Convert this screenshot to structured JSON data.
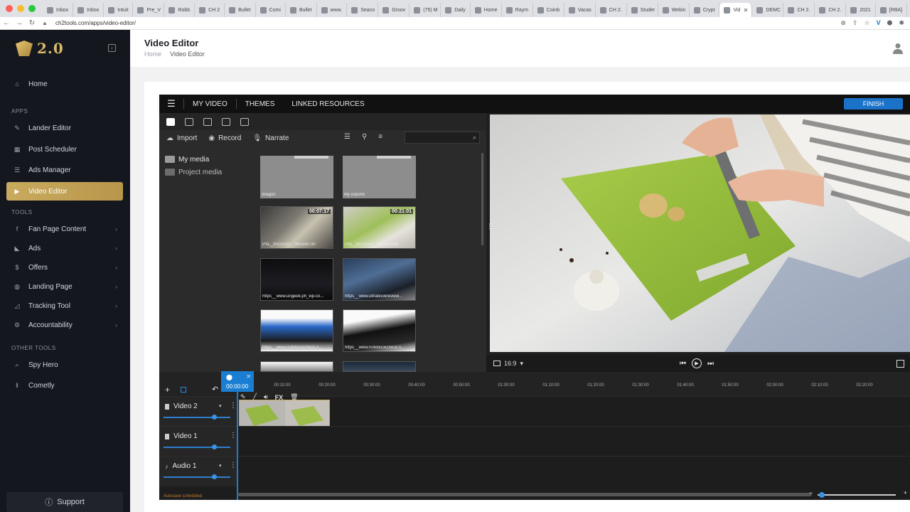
{
  "browser": {
    "tabs": [
      "Inbox",
      "Inbox",
      "Intuit",
      "Pre_V",
      "Robb",
      "CH 2",
      "Bullet",
      "Comi",
      "Bullet",
      "www.",
      "Seaco",
      "Groov",
      "(75) M",
      "Daily",
      "Home",
      "Raym",
      "Coinb",
      "Vacas",
      "CH 2.",
      "Studer",
      "Webin",
      "Crypt",
      "Vid",
      "DEMC",
      "CH 2.",
      "CH 2.",
      "2021",
      "[RBA]"
    ],
    "url": "ch2tools.com/apps/video-editor/"
  },
  "sidebar": {
    "logo_text": "2.0",
    "home": "Home",
    "apps_label": "APPS",
    "apps": [
      "Lander Editor",
      "Post Scheduler",
      "Ads Manager",
      "Video Editor"
    ],
    "tools_label": "TOOLS",
    "tools": [
      "Fan Page Content",
      "Ads",
      "Offers",
      "Landing Page",
      "Tracking Tool",
      "Accountability"
    ],
    "other_label": "OTHER TOOLS",
    "other": [
      "Spy Hero",
      "Cometly"
    ],
    "support": "Support"
  },
  "header": {
    "title": "Video Editor",
    "crumb_home": "Home",
    "crumb_current": "Video Editor"
  },
  "editor": {
    "tabs": [
      "MY VIDEO",
      "THEMES",
      "LINKED RESOURCES"
    ],
    "finish": "FINISH",
    "actions": {
      "import": "Import",
      "record": "Record",
      "narrate": "Narrate"
    },
    "folders": [
      "My media",
      "Project media"
    ],
    "media": [
      {
        "caption": "Images",
        "duration": ""
      },
      {
        "caption": "My exports",
        "duration": ""
      },
      {
        "caption": "PXL_20210207_095326730",
        "duration": "00:07:17"
      },
      {
        "caption": "PXL_20210207_094910336",
        "duration": "00:21:01"
      },
      {
        "caption": "https__www.ungeek.ph_wp-co...",
        "duration": ""
      },
      {
        "caption": "https__www.ultrabookreview...",
        "duration": ""
      },
      {
        "caption": "https__www.notebookcheck.n...",
        "duration": ""
      },
      {
        "caption": "https__www.notebookcheck.n...",
        "duration": ""
      }
    ],
    "aspect": "16:9",
    "timeline": {
      "playhead_time": "00:00:00",
      "clip_fx": "FX",
      "ticks": [
        "00:10:00",
        "00:20:00",
        "00:30:00",
        "00:40:00",
        "00:50:00",
        "01:00:00",
        "01:10:00",
        "01:20:00",
        "01:30:00",
        "01:40:00",
        "01:50:00",
        "02:00:00",
        "02:10:00",
        "02:20:00"
      ],
      "tracks": [
        "Video 2",
        "Video 1",
        "Audio 1"
      ],
      "autosave": "Autosave scheduled"
    }
  },
  "colors": {
    "accent_gold": "#c9ab5e",
    "editor_blue": "#1a73c9",
    "sidebar_bg": "#15171f"
  }
}
